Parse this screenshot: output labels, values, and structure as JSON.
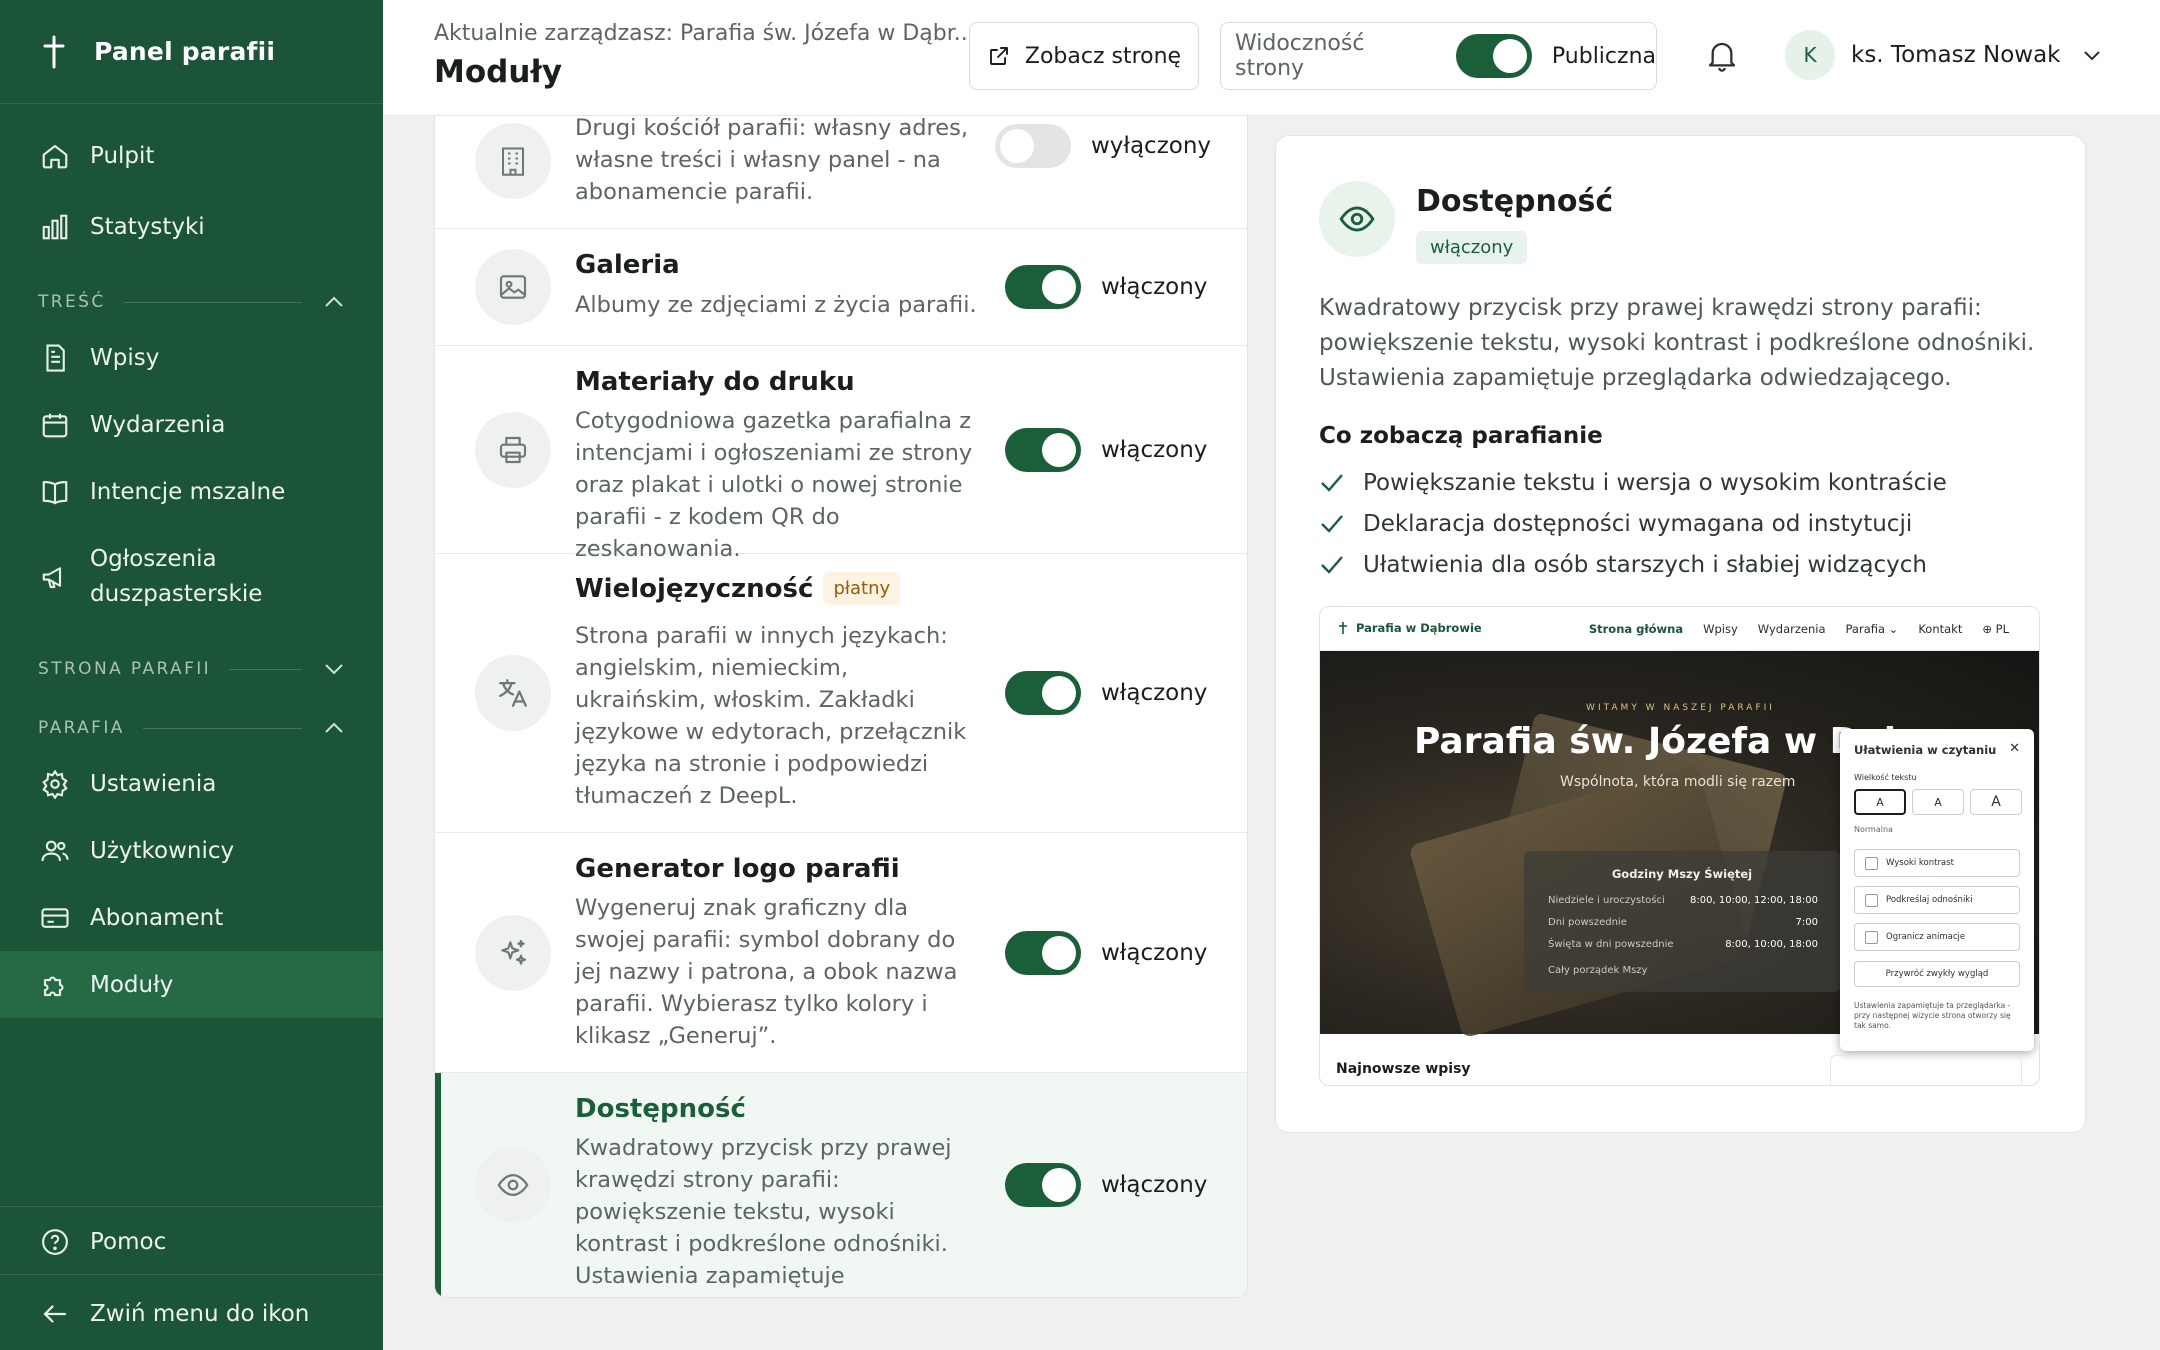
{
  "sidebar": {
    "brand": "Panel parafii",
    "items": {
      "pulpit": "Pulpit",
      "statystyki": "Statystyki",
      "wpisy": "Wpisy",
      "wydarzenia": "Wydarzenia",
      "intencje": "Intencje mszalne",
      "ogloszenia_1": "Ogłoszenia",
      "ogloszenia_2": "duszpasterskie",
      "ustawienia": "Ustawienia",
      "uzytkownicy": "Użytkownicy",
      "abonament": "Abonament",
      "moduly": "Moduły",
      "pomoc": "Pomoc",
      "zwin": "Zwiń menu do ikon"
    },
    "sections": {
      "tresc": "TREŚĆ",
      "strona": "STRONA PARAFII",
      "parafia": "PARAFIA"
    },
    "active": "moduly"
  },
  "topbar": {
    "subtitle": "Aktualnie zarządzasz: Parafia św. Józefa w Dąbr...",
    "title": "Moduły",
    "view_button": "Zobacz stronę",
    "visibility_label": "Widoczność strony",
    "visibility_value": "Publiczna",
    "visibility_on": true,
    "avatar_letter": "K",
    "user_name": "ks. Tomasz Nowak"
  },
  "modules": [
    {
      "title": "",
      "desc_1": "Drugi kościół parafii: własny adres,",
      "desc_2": "własne treści i własny panel - na",
      "desc_3": "abonamencie parafii.",
      "status": "wyłączony",
      "enabled": false,
      "icon": "building-icon"
    },
    {
      "title": "Galeria",
      "desc": "Albumy ze zdjęciami z życia parafii.",
      "status": "włączony",
      "enabled": true,
      "icon": "image-icon"
    },
    {
      "title": "Materiały do druku",
      "desc": "Cotygodniowa gazetka parafialna z intencjami i ogłoszeniami ze strony oraz plakat i ulotki o nowej stronie parafii - z kodem QR do zeskanowania.",
      "status": "włączony",
      "enabled": true,
      "icon": "printer-icon"
    },
    {
      "title": "Wielojęzyczność",
      "badge": "płatny",
      "desc": "Strona parafii w innych językach: angielskim, niemieckim, ukraińskim, włoskim. Zakładki językowe w edytorach, przełącznik języka na stronie i podpowiedzi tłumaczeń z DeepL.",
      "status": "włączony",
      "enabled": true,
      "icon": "translate-icon"
    },
    {
      "title": "Generator logo parafii",
      "desc": "Wygeneruj znak graficzny dla swojej parafii: symbol dobrany do jej nazwy i patrona, a obok nazwa parafii. Wybierasz tylko kolory i klikasz „Generuj”.",
      "status": "włączony",
      "enabled": true,
      "icon": "sparkles-icon"
    },
    {
      "title": "Dostępność",
      "desc": "Kwadratowy przycisk przy prawej krawędzi strony parafii: powiększenie tekstu, wysoki kontrast i podkreślone odnośniki. Ustawienia zapamiętuje przeglądarka odwiedzającego.",
      "status": "włączony",
      "enabled": true,
      "icon": "eye-icon",
      "selected": true
    }
  ],
  "detail": {
    "title": "Dostępność",
    "badge": "włączony",
    "desc": "Kwadratowy przycisk przy prawej krawędzi strony parafii: powiększenie tekstu, wysoki kontrast i podkreślone odnośniki. Ustawienia zapamiętuje przeglądarka odwiedzającego.",
    "subheading": "Co zobaczą parafianie",
    "points": [
      "Powiększanie tekstu i wersja o wysokim kontraście",
      "Deklaracja dostępności wymagana od instytucji",
      "Ułatwienia dla osób starszych i słabiej widzących"
    ],
    "preview": {
      "brand": "Parafia w Dąbrowie",
      "nav": [
        "Strona główna",
        "Wpisy",
        "Wydarzenia",
        "Parafia",
        "Kontakt",
        "PL"
      ],
      "kicker": "WITAMY W NASZEJ PARAFII",
      "hero_title": "Parafia św. Józefa w Dąbr",
      "hero_sub": "Wspólnota, która modli się razem",
      "card_title": "Godziny Mszy Świętej",
      "card_rows": [
        {
          "label": "Niedziele i uroczystości",
          "value": "8:00, 10:00, 12:00, 18:00"
        },
        {
          "label": "Dni powszednie",
          "value": "7:00"
        },
        {
          "label": "Święta w dni powszednie",
          "value": "8:00, 10:00, 18:00"
        }
      ],
      "card_link": "Cały porządek Mszy",
      "popup": {
        "title": "Ułatwienia w czytaniu",
        "size_label": "Wielkość tekstu",
        "sizes": [
          "A",
          "A",
          "A"
        ],
        "size_state": "Normalna",
        "options": [
          "Wysoki kontrast",
          "Podkreślaj odnośniki",
          "Ogranicz animacje"
        ],
        "reset": "Przywróć zwykły wygląd",
        "note": "Ustawienia zapamiętuje ta przeglądarka - przy następnej wizycie strona otworzy się tak samo."
      },
      "bottom_heading": "Najnowsze wpisy"
    }
  },
  "colors": {
    "brand": "#1b5436",
    "accent": "#1b5e3a",
    "paid": "#9a5b0b"
  }
}
